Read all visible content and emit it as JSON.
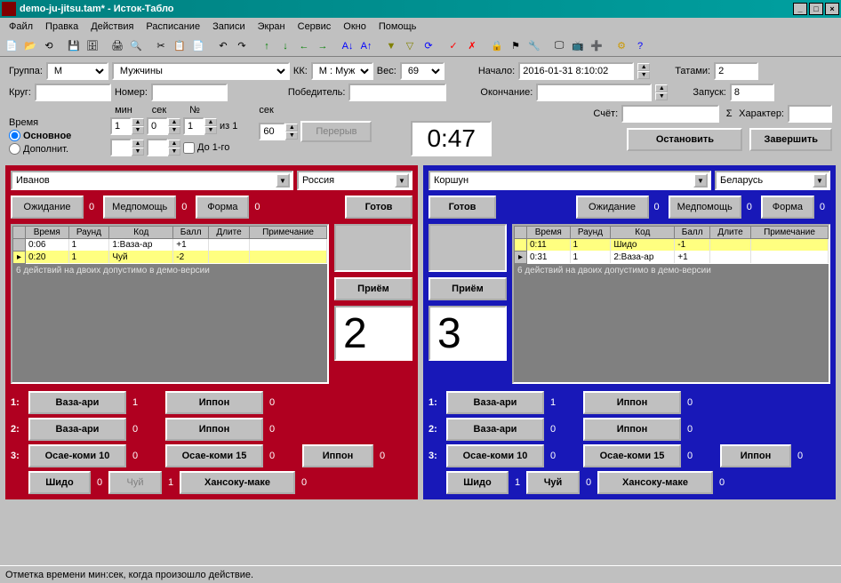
{
  "window": {
    "title": "demo-ju-jitsu.tam* - Исток-Табло"
  },
  "menu": [
    "Файл",
    "Правка",
    "Действия",
    "Расписание",
    "Записи",
    "Экран",
    "Сервис",
    "Окно",
    "Помощь"
  ],
  "form": {
    "group_lbl": "Группа:",
    "group_val": "М",
    "group_name": "Мужчины",
    "kk_lbl": "КК:",
    "kk_val": "М : Мужчи",
    "weight_lbl": "Вес:",
    "weight_val": "69",
    "start_lbl": "Начало:",
    "start_val": "2016-01-31 8:10:02",
    "tatami_lbl": "Татами:",
    "tatami_val": "2",
    "round_lbl": "Круг:",
    "number_lbl": "Номер:",
    "winner_lbl": "Победитель:",
    "end_lbl": "Окончание:",
    "launch_lbl": "Запуск:",
    "launch_val": "8",
    "score_lbl": "Счёт:",
    "char_lbl": "Характер:",
    "time_lbl": "Время",
    "main_lbl": "Основное",
    "extra_lbl": "Дополнит.",
    "min_lbl": "мин",
    "sec_lbl": "сек",
    "num_lbl": "№",
    "min_val": "1",
    "sec_val": "0",
    "num_val": "1",
    "of": "из 1",
    "sec2_lbl": "сек",
    "sec2_val": "60",
    "upto_lbl": "До 1-го",
    "break_btn": "Перерыв",
    "timer": "0:47",
    "stop_btn": "Остановить",
    "finish_btn": "Завершить"
  },
  "red": {
    "fighter": "Иванов",
    "country": "Россия",
    "wait": "Ожидание",
    "wait_n": "0",
    "med": "Медпомощь",
    "med_n": "0",
    "form": "Форма",
    "form_n": "0",
    "ready": "Готов",
    "accept": "Приём",
    "cols": [
      "",
      "Время",
      "Раунд",
      "Код",
      "Балл",
      "Длите",
      "Примечание"
    ],
    "rows": [
      {
        "t": "0:06",
        "r": "1",
        "c": "1:Ваза-ар",
        "b": "+1",
        "hl": false
      },
      {
        "t": "0:20",
        "r": "1",
        "c": "Чуй",
        "b": "-2",
        "hl": true
      }
    ],
    "demo": "6 действий на двоих допустимо в демо-версии",
    "score": "2",
    "a1": "Ваза-ари",
    "a1n": "1",
    "a2": "Иппон",
    "a2n": "0",
    "b1": "Ваза-ари",
    "b1n": "0",
    "b2": "Иппон",
    "b2n": "0",
    "c1": "Осае-коми 10",
    "c1n": "0",
    "c2": "Осае-коми 15",
    "c2n": "0",
    "c3": "Иппон",
    "c3n": "0",
    "d1": "Шидо",
    "d1n": "0",
    "d2": "Чуй",
    "d2n": "1",
    "d3": "Хансоку-маке",
    "d3n": "0"
  },
  "blue": {
    "fighter": "Коршун",
    "country": "Беларусь",
    "wait": "Ожидание",
    "wait_n": "0",
    "med": "Медпомощь",
    "med_n": "0",
    "form": "Форма",
    "form_n": "0",
    "ready": "Готов",
    "accept": "Приём",
    "cols": [
      "",
      "Время",
      "Раунд",
      "Код",
      "Балл",
      "Длите",
      "Примечание"
    ],
    "rows": [
      {
        "t": "0:11",
        "r": "1",
        "c": "Шидо",
        "b": "-1",
        "hl": true
      },
      {
        "t": "0:31",
        "r": "1",
        "c": "2:Ваза-ар",
        "b": "+1",
        "hl": false
      }
    ],
    "demo": "6 действий на двоих допустимо в демо-версии",
    "score": "3",
    "a1": "Ваза-ари",
    "a1n": "1",
    "a2": "Иппон",
    "a2n": "0",
    "b1": "Ваза-ари",
    "b1n": "0",
    "b2": "Иппон",
    "b2n": "0",
    "c1": "Осае-коми 10",
    "c1n": "0",
    "c2": "Осае-коми 15",
    "c2n": "0",
    "c3": "Иппон",
    "c3n": "0",
    "d1": "Шидо",
    "d1n": "1",
    "d2": "Чуй",
    "d2n": "0",
    "d3": "Хансоку-маке",
    "d3n": "0"
  },
  "status": "Отметка времени мин:сек, когда произошло действие."
}
